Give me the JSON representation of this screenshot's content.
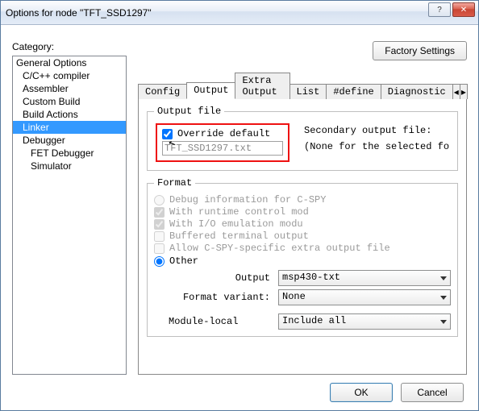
{
  "window": {
    "title": "Options for node \"TFT_SSD1297\""
  },
  "category": {
    "label": "Category:",
    "items": [
      {
        "label": "General Options",
        "indent": 0
      },
      {
        "label": "C/C++ compiler",
        "indent": 1
      },
      {
        "label": "Assembler",
        "indent": 1
      },
      {
        "label": "Custom Build",
        "indent": 1
      },
      {
        "label": "Build Actions",
        "indent": 1
      },
      {
        "label": "Linker",
        "indent": 1,
        "selected": true
      },
      {
        "label": "Debugger",
        "indent": 1
      },
      {
        "label": "FET Debugger",
        "indent": 2
      },
      {
        "label": "Simulator",
        "indent": 2
      }
    ]
  },
  "factory_btn": "Factory Settings",
  "tabs": [
    "Config",
    "Output",
    "Extra Output",
    "List",
    "#define",
    "Diagnostic"
  ],
  "active_tab": 1,
  "output_file": {
    "legend": "Output file",
    "override_label": "Override default",
    "override_checked": true,
    "filename": "TFT_SSD1297.txt",
    "secondary_label": "Secondary output file:",
    "secondary_value": "(None for the selected fo"
  },
  "format": {
    "legend": "Format",
    "debug_label": "Debug information for C-SPY",
    "runtime_label": "With runtime control mod",
    "ioemu_label": "With I/O emulation modu",
    "buffered_label": "Buffered terminal output",
    "allow_label": "Allow C-SPY-specific extra output file",
    "other_label": "Other",
    "other_selected": true,
    "output_label": "Output",
    "output_value": "msp430-txt",
    "variant_label": "Format variant:",
    "variant_value": "None",
    "module_label": "Module-local",
    "module_value": "Include all"
  },
  "footer": {
    "ok": "OK",
    "cancel": "Cancel"
  }
}
